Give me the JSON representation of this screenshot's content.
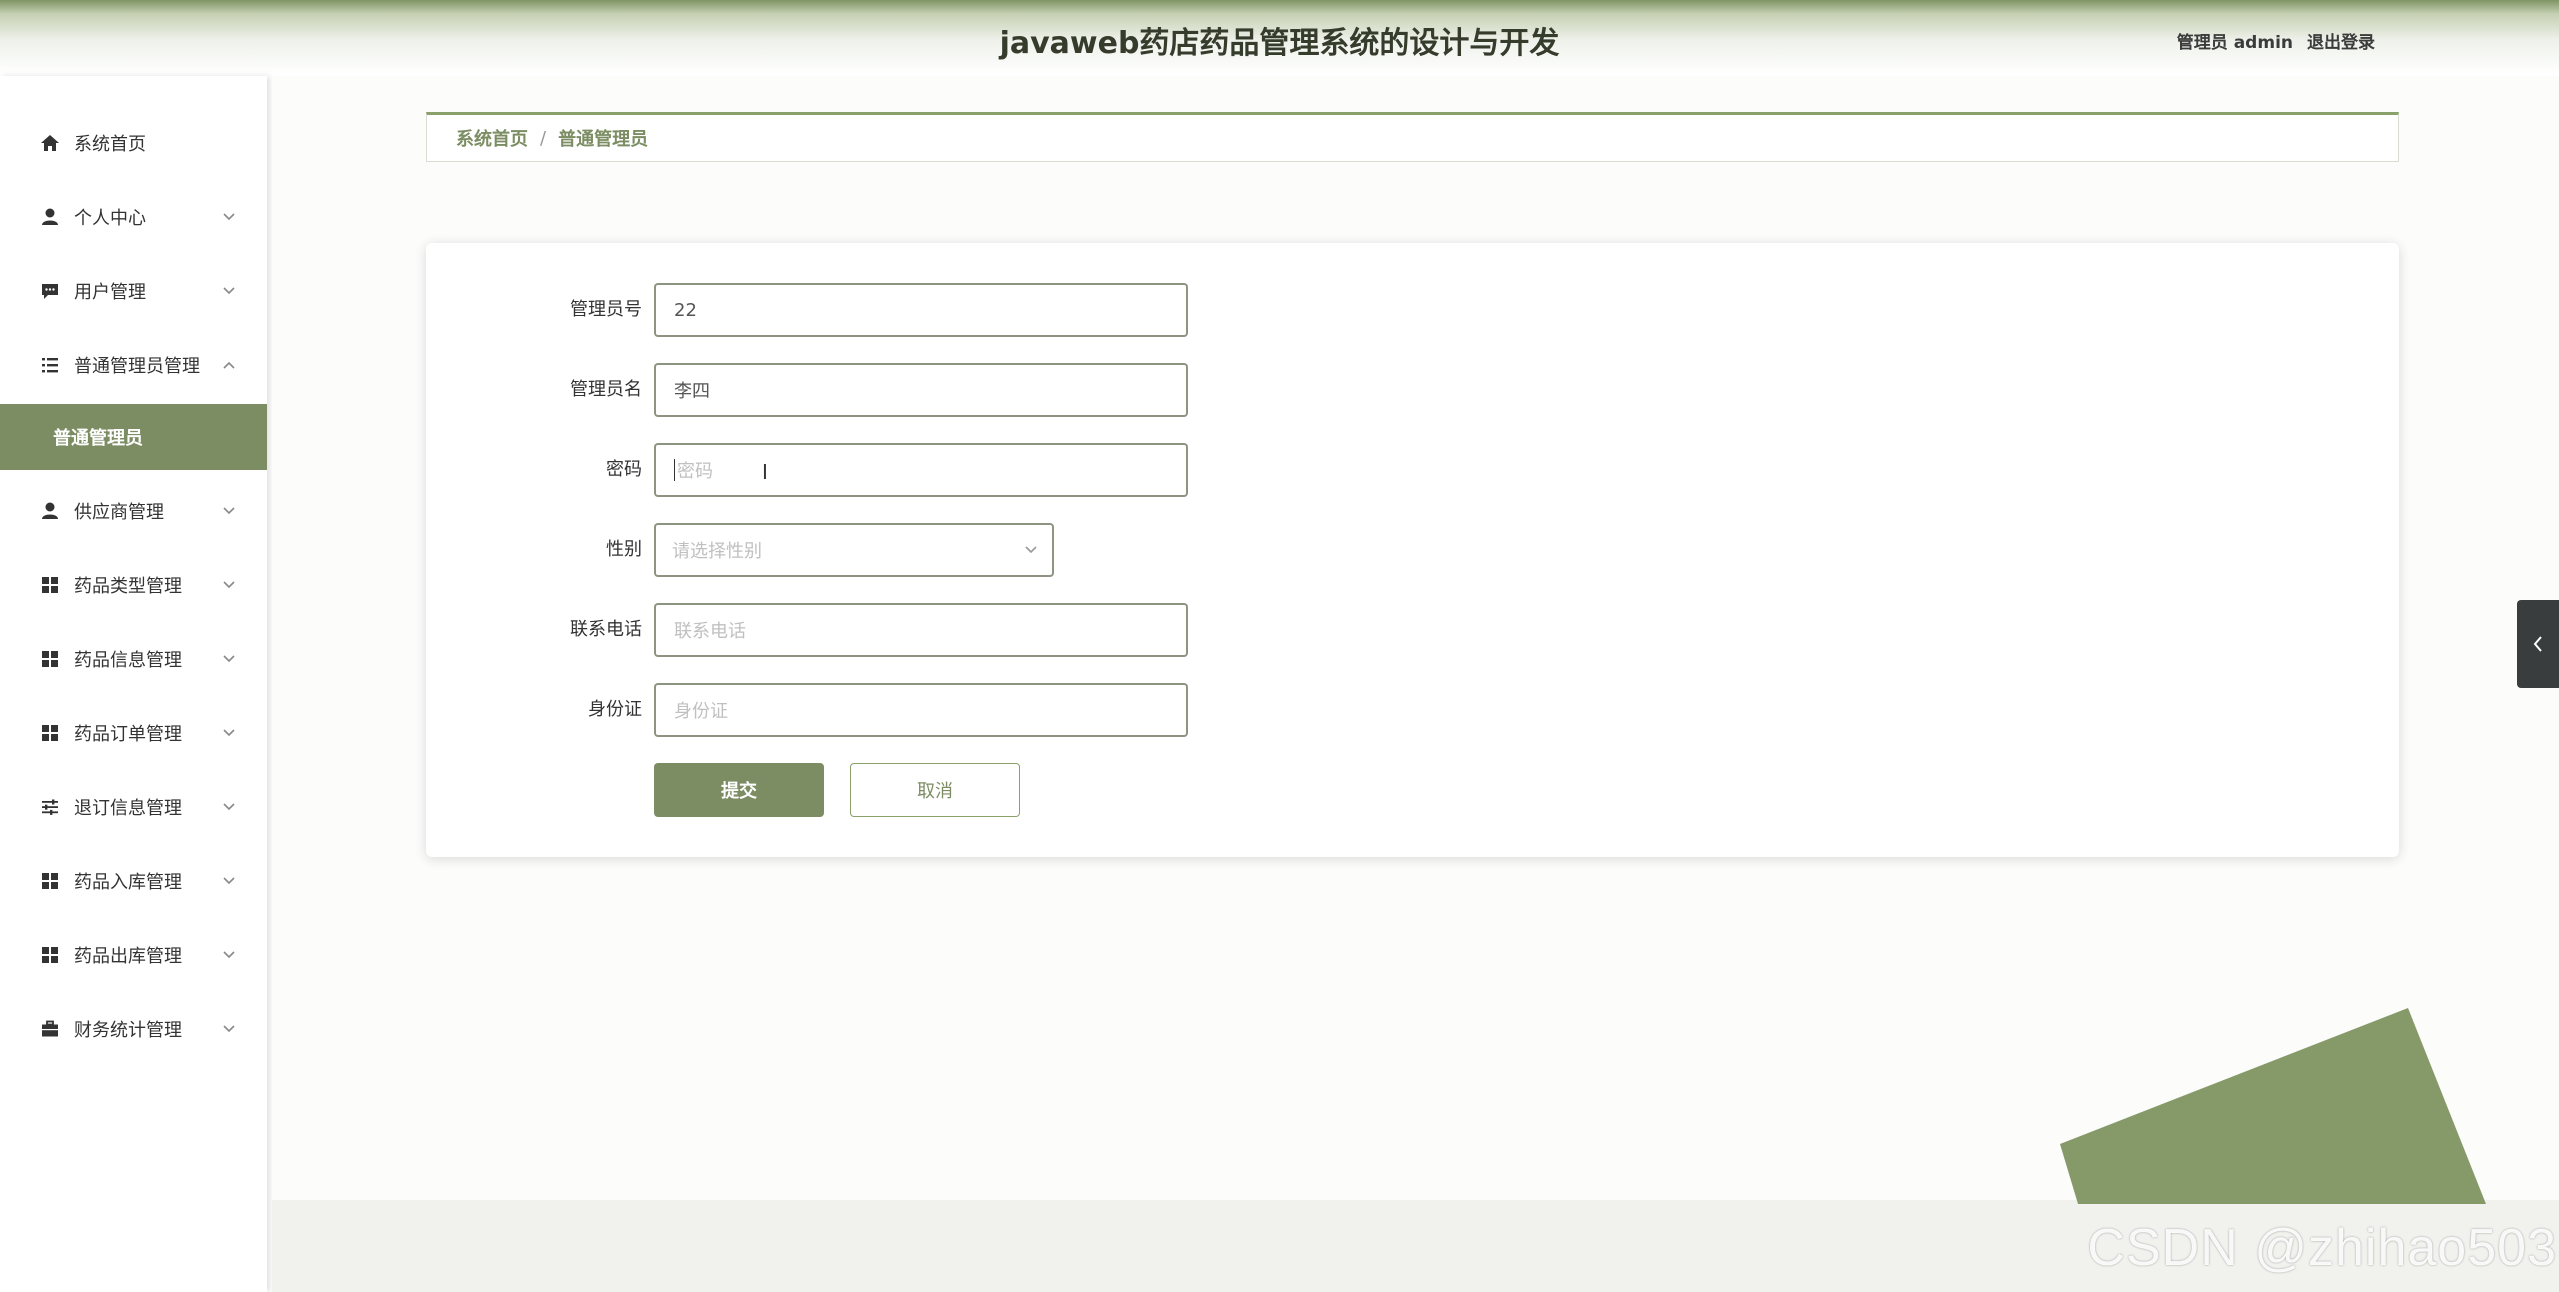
{
  "header": {
    "title": "javaweb药店药品管理系统的设计与开发",
    "user_label": "管理员 admin",
    "logout_label": "退出登录"
  },
  "sidebar": {
    "items": [
      {
        "label": "系统首页",
        "icon": "home-icon"
      },
      {
        "label": "个人中心",
        "icon": "person-icon"
      },
      {
        "label": "用户管理",
        "icon": "chat-icon"
      },
      {
        "label": "普通管理员管理",
        "icon": "list-icon"
      },
      {
        "label": "供应商管理",
        "icon": "person-icon"
      },
      {
        "label": "药品类型管理",
        "icon": "grid-icon"
      },
      {
        "label": "药品信息管理",
        "icon": "grid-icon"
      },
      {
        "label": "药品订单管理",
        "icon": "grid-icon"
      },
      {
        "label": "退订信息管理",
        "icon": "sliders-icon"
      },
      {
        "label": "药品入库管理",
        "icon": "grid-icon"
      },
      {
        "label": "药品出库管理",
        "icon": "grid-icon"
      },
      {
        "label": "财务统计管理",
        "icon": "briefcase-icon"
      }
    ],
    "active_submenu": "普通管理员"
  },
  "breadcrumb": {
    "home": "系统首页",
    "separator": "/",
    "current": "普通管理员"
  },
  "form": {
    "fields": [
      {
        "label": "管理员号",
        "value": "22",
        "placeholder": ""
      },
      {
        "label": "管理员名",
        "value": "李四",
        "placeholder": ""
      },
      {
        "label": "密码",
        "value": "",
        "placeholder": "密码"
      },
      {
        "label": "性别",
        "value": "",
        "placeholder": "请选择性别"
      },
      {
        "label": "联系电话",
        "value": "",
        "placeholder": "联系电话"
      },
      {
        "label": "身份证",
        "value": "",
        "placeholder": "身份证"
      }
    ],
    "submit_label": "提交",
    "cancel_label": "取消"
  },
  "watermark": "CSDN @zhihao503",
  "colors": {
    "accent": "#7c8d63",
    "sidebar_active": "#7c8d63",
    "decoration": "#869a69"
  }
}
